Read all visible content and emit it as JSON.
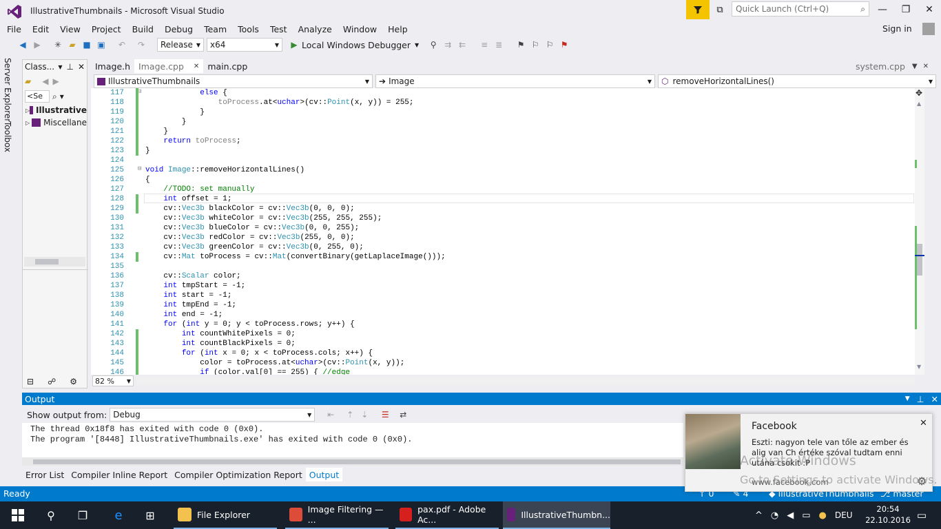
{
  "window": {
    "title": "IllustrativeThumbnails - Microsoft Visual Studio",
    "quick_launch_placeholder": "Quick Launch (Ctrl+Q)"
  },
  "menu": {
    "items": [
      "File",
      "Edit",
      "View",
      "Project",
      "Build",
      "Debug",
      "Team",
      "Tools",
      "Test",
      "Analyze",
      "Window",
      "Help"
    ],
    "sign_in": "Sign in"
  },
  "toolbar": {
    "configuration": "Release",
    "platform": "x64",
    "debugger": "Local Windows Debugger"
  },
  "side_tabs": [
    "Server Explorer",
    "Toolbox"
  ],
  "class_view": {
    "title": "Class...",
    "search_value": "<Se",
    "items": [
      {
        "label": "Illustrative",
        "bold": true
      },
      {
        "label": "Miscellane",
        "bold": false
      }
    ]
  },
  "doc_tabs": {
    "tabs": [
      "Image.h",
      "Image.cpp",
      "main.cpp"
    ],
    "active": "Image.cpp",
    "pinned_right": "system.cpp"
  },
  "nav_bar": {
    "project": "IllustrativeThumbnails",
    "scope": "Image",
    "member": "removeHorizontalLines()"
  },
  "editor": {
    "zoom": "82 %",
    "lines": [
      {
        "n": "117",
        "chg": true,
        "segs": [
          [
            "            ",
            ""
          ],
          [
            "else",
            "kw"
          ],
          [
            " {",
            ""
          ]
        ]
      },
      {
        "n": "118",
        "chg": true,
        "segs": [
          [
            "                ",
            ""
          ],
          [
            "toProcess",
            "vr"
          ],
          [
            ".at<",
            ""
          ],
          [
            "uchar",
            "kw"
          ],
          [
            ">(cv::",
            ""
          ],
          [
            "Point",
            "ty"
          ],
          [
            "(x, y)) = 255;",
            ""
          ]
        ]
      },
      {
        "n": "119",
        "chg": true,
        "segs": [
          [
            "            }",
            ""
          ]
        ]
      },
      {
        "n": "120",
        "chg": true,
        "segs": [
          [
            "        }",
            ""
          ]
        ]
      },
      {
        "n": "121",
        "chg": true,
        "segs": [
          [
            "    }",
            ""
          ]
        ]
      },
      {
        "n": "122",
        "chg": true,
        "segs": [
          [
            "    ",
            ""
          ],
          [
            "return",
            "kw"
          ],
          [
            " ",
            ""
          ],
          [
            "toProcess",
            "vr"
          ],
          [
            ";",
            ""
          ]
        ]
      },
      {
        "n": "123",
        "chg": true,
        "segs": [
          [
            "}",
            ""
          ]
        ]
      },
      {
        "n": "124",
        "chg": false,
        "segs": []
      },
      {
        "n": "125",
        "chg": false,
        "segs": [
          [
            "void",
            "kw"
          ],
          [
            " ",
            ""
          ],
          [
            "Image",
            "ty"
          ],
          [
            "::removeHorizontalLines()",
            ""
          ]
        ]
      },
      {
        "n": "126",
        "chg": false,
        "segs": [
          [
            "{",
            ""
          ]
        ]
      },
      {
        "n": "127",
        "chg": false,
        "segs": [
          [
            "    ",
            ""
          ],
          [
            "//TODO: set manually",
            "cm"
          ]
        ]
      },
      {
        "n": "128",
        "chg": true,
        "segs": [
          [
            "    ",
            ""
          ],
          [
            "int",
            "kw"
          ],
          [
            " offset = 1;",
            ""
          ]
        ]
      },
      {
        "n": "129",
        "chg": true,
        "segs": [
          [
            "    cv::",
            ""
          ],
          [
            "Vec3b",
            "ty"
          ],
          [
            " blackColor = cv::",
            ""
          ],
          [
            "Vec3b",
            "ty"
          ],
          [
            "(0, 0, 0);",
            ""
          ]
        ]
      },
      {
        "n": "130",
        "chg": false,
        "segs": [
          [
            "    cv::",
            ""
          ],
          [
            "Vec3b",
            "ty"
          ],
          [
            " whiteColor = cv::",
            ""
          ],
          [
            "Vec3b",
            "ty"
          ],
          [
            "(255, 255, 255);",
            ""
          ]
        ]
      },
      {
        "n": "131",
        "chg": false,
        "segs": [
          [
            "    cv::",
            ""
          ],
          [
            "Vec3b",
            "ty"
          ],
          [
            " blueColor = cv::",
            ""
          ],
          [
            "Vec3b",
            "ty"
          ],
          [
            "(0, 0, 255);",
            ""
          ]
        ]
      },
      {
        "n": "132",
        "chg": false,
        "segs": [
          [
            "    cv::",
            ""
          ],
          [
            "Vec3b",
            "ty"
          ],
          [
            " redColor = cv::",
            ""
          ],
          [
            "Vec3b",
            "ty"
          ],
          [
            "(255, 0, 0);",
            ""
          ]
        ]
      },
      {
        "n": "133",
        "chg": false,
        "segs": [
          [
            "    cv::",
            ""
          ],
          [
            "Vec3b",
            "ty"
          ],
          [
            " greenColor = cv::",
            ""
          ],
          [
            "Vec3b",
            "ty"
          ],
          [
            "(0, 255, 0);",
            ""
          ]
        ]
      },
      {
        "n": "134",
        "chg": true,
        "segs": [
          [
            "    cv::",
            ""
          ],
          [
            "Mat",
            "ty"
          ],
          [
            " toProcess = cv::",
            ""
          ],
          [
            "Mat",
            "ty"
          ],
          [
            "(convertBinary(getLaplaceImage()));",
            ""
          ]
        ]
      },
      {
        "n": "135",
        "chg": false,
        "segs": []
      },
      {
        "n": "136",
        "chg": false,
        "segs": [
          [
            "    cv::",
            ""
          ],
          [
            "Scalar",
            "ty"
          ],
          [
            " color;",
            ""
          ]
        ]
      },
      {
        "n": "137",
        "chg": false,
        "segs": [
          [
            "    ",
            ""
          ],
          [
            "int",
            "kw"
          ],
          [
            " tmpStart = -1;",
            ""
          ]
        ]
      },
      {
        "n": "138",
        "chg": false,
        "segs": [
          [
            "    ",
            ""
          ],
          [
            "int",
            "kw"
          ],
          [
            " start = -1;",
            ""
          ]
        ]
      },
      {
        "n": "139",
        "chg": false,
        "segs": [
          [
            "    ",
            ""
          ],
          [
            "int",
            "kw"
          ],
          [
            " tmpEnd = -1;",
            ""
          ]
        ]
      },
      {
        "n": "140",
        "chg": false,
        "segs": [
          [
            "    ",
            ""
          ],
          [
            "int",
            "kw"
          ],
          [
            " end = -1;",
            ""
          ]
        ]
      },
      {
        "n": "141",
        "chg": false,
        "segs": [
          [
            "    ",
            ""
          ],
          [
            "for",
            "kw"
          ],
          [
            " (",
            ""
          ],
          [
            "int",
            "kw"
          ],
          [
            " y = 0; y < toProcess.rows; y++) {",
            ""
          ]
        ]
      },
      {
        "n": "142",
        "chg": true,
        "segs": [
          [
            "        ",
            ""
          ],
          [
            "int",
            "kw"
          ],
          [
            " countWhitePixels = 0;",
            ""
          ]
        ]
      },
      {
        "n": "143",
        "chg": true,
        "segs": [
          [
            "        ",
            ""
          ],
          [
            "int",
            "kw"
          ],
          [
            " countBlackPixels = 0;",
            ""
          ]
        ]
      },
      {
        "n": "144",
        "chg": true,
        "segs": [
          [
            "        ",
            ""
          ],
          [
            "for",
            "kw"
          ],
          [
            " (",
            ""
          ],
          [
            "int",
            "kw"
          ],
          [
            " x = 0; x < toProcess.cols; x++) {",
            ""
          ]
        ]
      },
      {
        "n": "145",
        "chg": true,
        "segs": [
          [
            "            color = toProcess.at<",
            ""
          ],
          [
            "uchar",
            "kw"
          ],
          [
            ">(cv::",
            ""
          ],
          [
            "Point",
            "ty"
          ],
          [
            "(x, y));",
            ""
          ]
        ]
      },
      {
        "n": "146",
        "chg": true,
        "segs": [
          [
            "            ",
            ""
          ],
          [
            "if",
            "kw"
          ],
          [
            " (color.val[0] == 255) { ",
            ""
          ],
          [
            "//edge",
            "cm"
          ]
        ]
      }
    ]
  },
  "output": {
    "title": "Output",
    "show_from_label": "Show output from:",
    "show_from_value": "Debug",
    "lines": [
      "The thread 0x18f8 has exited with code 0 (0x0).",
      "The program '[8448] IllustrativeThumbnails.exe' has exited with code 0 (0x0)."
    ]
  },
  "bottom_tabs": {
    "tabs": [
      "Error List",
      "Compiler Inline Report",
      "Compiler Optimization Report",
      "Output"
    ],
    "active": "Output"
  },
  "status": {
    "ready": "Ready",
    "up_count": "0",
    "pencil_count": "4",
    "repo": "IllustrativeThumbnails",
    "branch": "master"
  },
  "toast": {
    "app": "Facebook",
    "message": "Eszti: nagyon tele van tőle az ember és alig van Ch értéke szóval tudtam enni utána csokit :P",
    "source": "www.facebook.com"
  },
  "watermark": {
    "line1": "Activate Windows",
    "line2": "Go to Settings to activate Windows."
  },
  "taskbar": {
    "items": [
      {
        "label": "File Explorer",
        "color": "#f2c14e"
      },
      {
        "label": "Image Filtering — ...",
        "color": "#dd4b39"
      },
      {
        "label": "pax.pdf - Adobe Ac...",
        "color": "#d6201e"
      },
      {
        "label": "IllustrativeThumbn...",
        "color": "#68217a"
      }
    ],
    "language": "DEU",
    "time": "20:54",
    "date": "22.10.2016"
  },
  "colors": {
    "accent": "#007acc",
    "vs_purple": "#68217a",
    "filter_yellow": "#f5c400",
    "change_green": "#6cc06c"
  }
}
